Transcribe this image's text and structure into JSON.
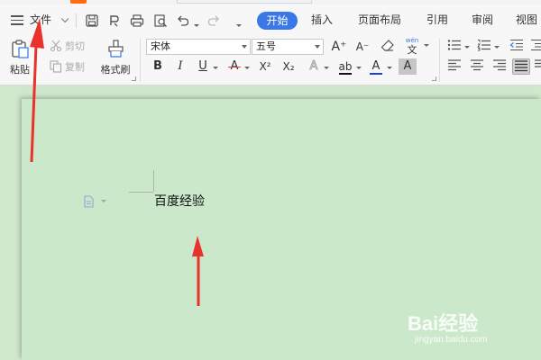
{
  "menubar": {
    "file_label": "文件",
    "tabs": [
      {
        "label": "开始",
        "active": true
      },
      {
        "label": "插入"
      },
      {
        "label": "页面布局"
      },
      {
        "label": "引用"
      },
      {
        "label": "审阅"
      },
      {
        "label": "视图"
      }
    ]
  },
  "ribbon": {
    "paste_label": "粘贴",
    "cut_label": "剪切",
    "copy_label": "复制",
    "format_painter_label": "格式刷",
    "font_name": "宋体",
    "font_size": "五号",
    "bold_glyph": "B",
    "italic_glyph": "I",
    "underline_glyph": "U",
    "strike_glyph": "A",
    "superscript_glyph": "X²",
    "subscript_glyph": "X₂",
    "text_effect_glyph": "A",
    "highlight_glyph": "ab",
    "font_color_glyph": "A",
    "char_shading_glyph": "A",
    "grow_font_glyph": "A⁺",
    "shrink_font_glyph": "A⁻",
    "pinyin_top": "wén",
    "pinyin_bottom": "文"
  },
  "document": {
    "body_text": "百度经验"
  },
  "watermark": {
    "brand": "Bai经验",
    "url": "jingyan.baidu.com"
  },
  "colors": {
    "accent": "#3b78e7",
    "annotation_arrow": "#e8322b",
    "page_bg": "#cce8cb"
  }
}
